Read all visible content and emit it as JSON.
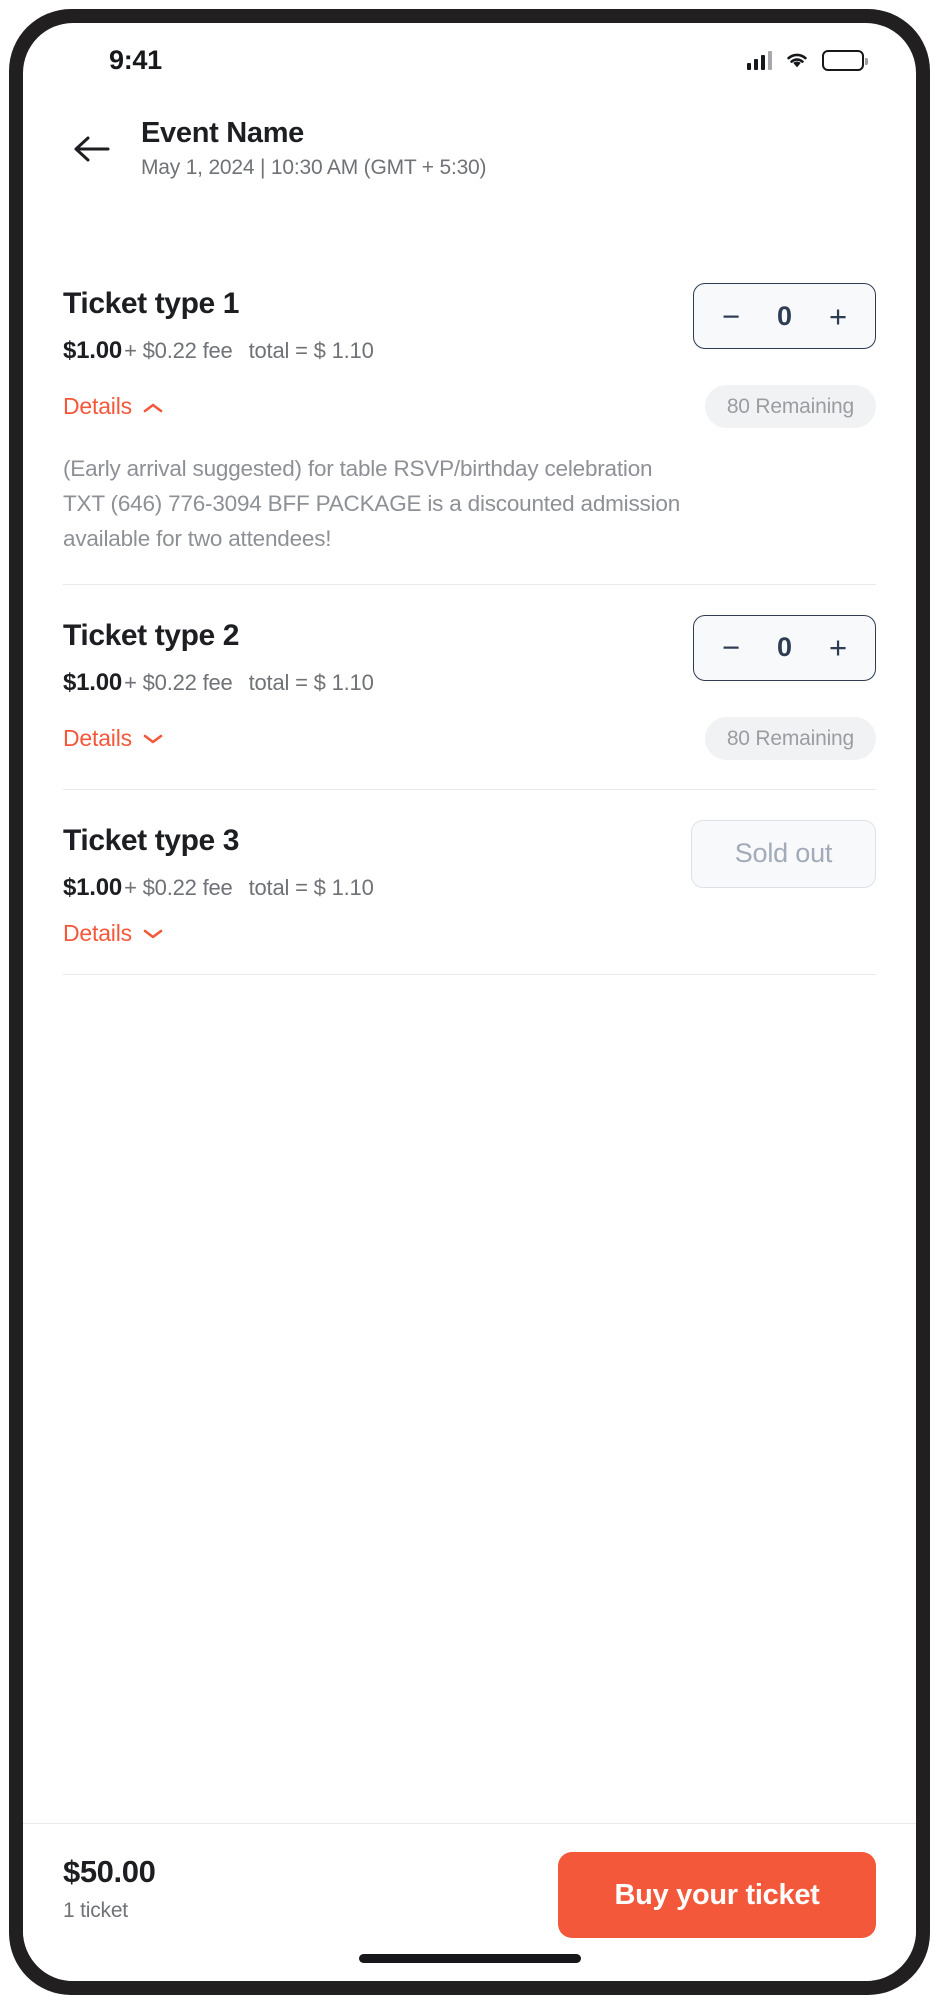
{
  "status_bar": {
    "time": "9:41",
    "signal_icon": "cellular-signal-icon",
    "wifi_icon": "wifi-icon",
    "battery_icon": "battery-icon"
  },
  "header": {
    "back_icon": "back-arrow-icon",
    "title": "Event Name",
    "subtitle": "May 1, 2024 | 10:30 AM (GMT + 5:30)"
  },
  "tickets": [
    {
      "name": "Ticket type 1",
      "price": "$1.00",
      "fee": "+ $0.22 fee",
      "total": "total = $ 1.10",
      "stepper": {
        "decrement_label": "−",
        "value": "0",
        "increment_label": "+"
      },
      "details_label": "Details",
      "details_expanded": true,
      "remaining": "80 Remaining",
      "description": "(Early arrival suggested) for table RSVP/birthday celebration TXT (646) 776-3094 BFF PACKAGE is a discounted admission available for two attendees!"
    },
    {
      "name": "Ticket type 2",
      "price": "$1.00",
      "fee": "+ $0.22 fee",
      "total": "total = $ 1.10",
      "stepper": {
        "decrement_label": "−",
        "value": "0",
        "increment_label": "+"
      },
      "details_label": "Details",
      "details_expanded": false,
      "remaining": "80 Remaining"
    },
    {
      "name": "Ticket type 3",
      "price": "$1.00",
      "fee": "+ $0.22 fee",
      "total": "total = $ 1.10",
      "sold_out_label": "Sold out",
      "details_label": "Details",
      "details_expanded": false
    }
  ],
  "footer": {
    "total_amount": "$50.00",
    "ticket_count": "1 ticket",
    "buy_label": "Buy your ticket"
  },
  "colors": {
    "accent": "#f4583a",
    "stepper_border": "#2f3d53",
    "muted_text": "#6f7276",
    "pill_bg": "#f1f2f3"
  }
}
